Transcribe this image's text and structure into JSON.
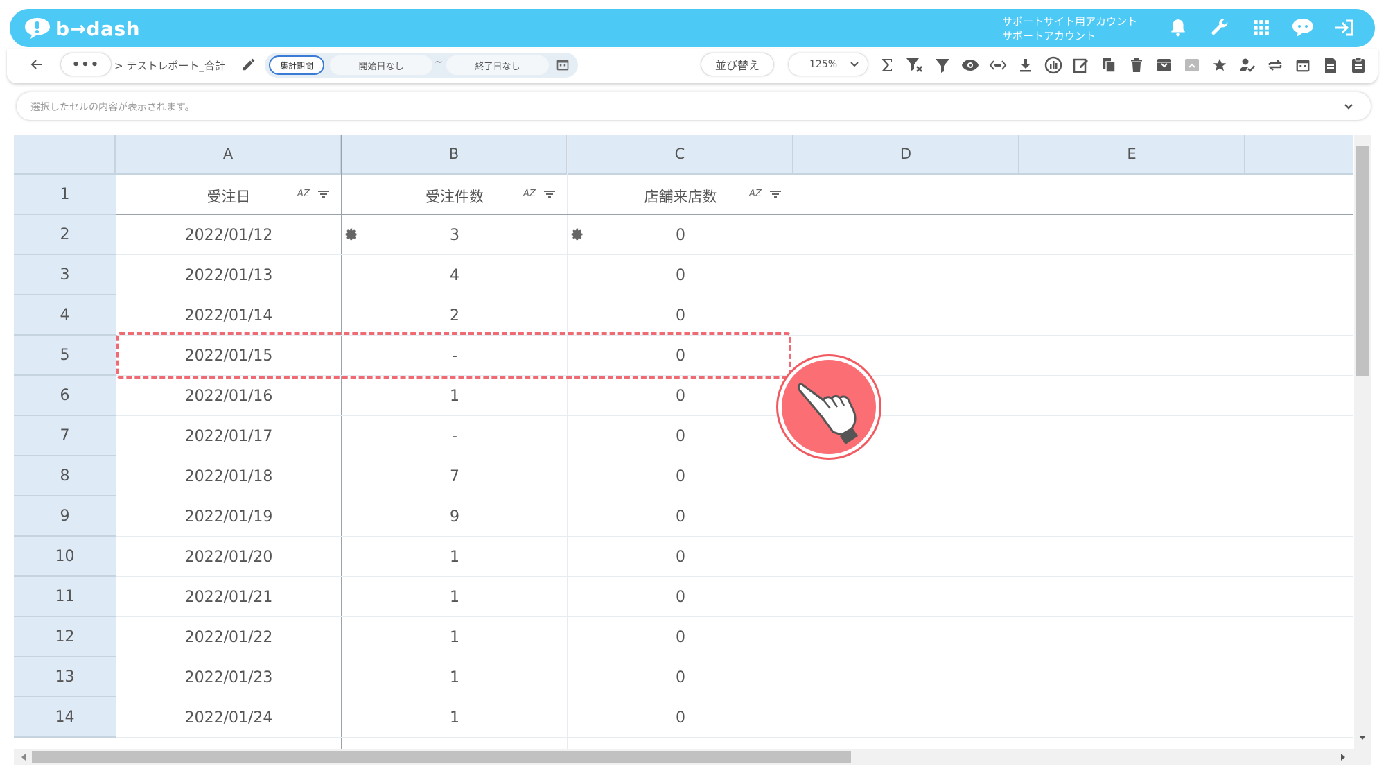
{
  "app": {
    "logo_text": "b→dash",
    "brand_color": "#4dc9f6"
  },
  "account": {
    "line1": "サポートサイト用アカウント",
    "line2": "サポートアカウント"
  },
  "top_icons": [
    "bell-icon",
    "wrench-icon",
    "grid-apps-icon",
    "chat-bubble-icon",
    "logout-icon"
  ],
  "toolbar": {
    "more_label": "•••",
    "breadcrumb": "> テストレポート_合計",
    "period_label": "集計期間",
    "date_start": "開始日なし",
    "tilde": "~",
    "date_end": "終了日なし",
    "sort_label": "並び替え",
    "zoom_value": "125%",
    "tools": [
      "sum-icon",
      "filter-clear-icon",
      "filter-icon",
      "eye-icon",
      "code-icon",
      "download-icon",
      "chart-icon",
      "edit-icon",
      "copy-icon",
      "trash-icon",
      "archive-icon",
      "unarchive-icon",
      "star-icon",
      "user-check-icon",
      "swap-icon",
      "calendar-icon",
      "document-icon",
      "clipboard-icon"
    ]
  },
  "formula_bar": {
    "placeholder": "選択したセルの内容が表示されます。"
  },
  "columns": [
    "A",
    "B",
    "C",
    "D",
    "E"
  ],
  "header_row": {
    "row_number": "1",
    "cells": [
      "受注日",
      "受注件数",
      "店舗来店数"
    ],
    "sort_label": "AZ"
  },
  "rows": [
    {
      "n": "2",
      "a": "2022/01/12",
      "b": "3",
      "c": "0"
    },
    {
      "n": "3",
      "a": "2022/01/13",
      "b": "4",
      "c": "0"
    },
    {
      "n": "4",
      "a": "2022/01/14",
      "b": "2",
      "c": "0"
    },
    {
      "n": "5",
      "a": "2022/01/15",
      "b": "-",
      "c": "0"
    },
    {
      "n": "6",
      "a": "2022/01/16",
      "b": "1",
      "c": "0"
    },
    {
      "n": "7",
      "a": "2022/01/17",
      "b": "-",
      "c": "0"
    },
    {
      "n": "8",
      "a": "2022/01/18",
      "b": "7",
      "c": "0"
    },
    {
      "n": "9",
      "a": "2022/01/19",
      "b": "9",
      "c": "0"
    },
    {
      "n": "10",
      "a": "2022/01/20",
      "b": "1",
      "c": "0"
    },
    {
      "n": "11",
      "a": "2022/01/21",
      "b": "1",
      "c": "0"
    },
    {
      "n": "12",
      "a": "2022/01/22",
      "b": "1",
      "c": "0"
    },
    {
      "n": "13",
      "a": "2022/01/23",
      "b": "1",
      "c": "0"
    },
    {
      "n": "14",
      "a": "2022/01/24",
      "b": "1",
      "c": "0"
    }
  ],
  "highlight": {
    "row": "5",
    "color": "#f06a73"
  }
}
